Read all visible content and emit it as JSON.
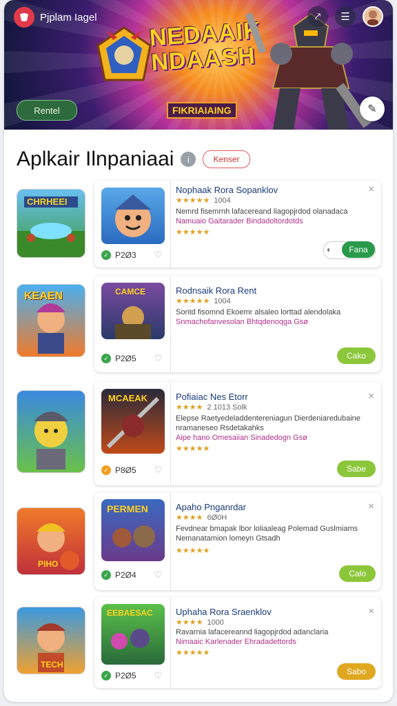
{
  "app": {
    "brand": "Pjplam Iagel"
  },
  "hero": {
    "title": "NEDAAIK NDAASH",
    "subtitle": "FIKRIAIAING",
    "button": "Rentel"
  },
  "section": {
    "title": "Aplkair Ilnpaniaai",
    "filter_button": "Kenser"
  },
  "rows": [
    {
      "left_label": "CHRHEEI",
      "card_label": "",
      "title": "Nophaak Rora Sopanklov",
      "stars": "★★★★★",
      "count": "1004",
      "desc": "Nemrd  fisemrnh lafacereand liagopjrdod olanadaca",
      "desc2": "Namuaio Gaitarader Bindadoltordotds",
      "stars2": "★★★★★",
      "price": "P2Ø3",
      "action": "Fana",
      "action_color": "#2a9a4a",
      "toggle": true
    },
    {
      "left_label": "KEAEN",
      "card_label": "CAMCE",
      "title": "Rodnsaik Rora Rent",
      "stars": "★★★★★",
      "count": "1004",
      "desc": "Sontd  fisomnd Ekoemr alsaleo lorttad alendolaka",
      "desc2": "Snmachofanvesolan Bhtqdenoqga Gsø",
      "stars2": "",
      "price": "P2Ø5",
      "action": "Cako",
      "action_color": "#8cc63a",
      "toggle": false
    },
    {
      "left_label": "",
      "card_label": "MCAEAK",
      "title": "Pofiaiac Nes Etorr",
      "stars": "★★★★",
      "count": "2 1013 Solk",
      "desc": "Elepse Raetyedeladdentereniagun Dierdeniaredubaine nramaneseo Rsdetakahks",
      "desc2": "Aipe hano Omesaiian Sinadedogn Gsø",
      "stars2": "★★★★★",
      "price": "P8Ø5",
      "action": "Sabe",
      "action_color": "#8cc63a",
      "toggle": false
    },
    {
      "left_label": "PIHO",
      "card_label": "PERMEN",
      "title": "Apaho Pnganrdar",
      "stars": "★★★★",
      "count": "6Ø0H",
      "desc": "Fevdnear bmapak lbor loliaaleag Polemad Guslmiams Nemanatamion lomeyn Gtsadh",
      "desc2": "",
      "stars2": "★★★★★",
      "price": "P2Ø4",
      "action": "Calo",
      "action_color": "#8cc63a",
      "toggle": false
    },
    {
      "left_label": "TECH",
      "card_label": "EEBAESAC",
      "title": "Uphaha Rora Sraenklov",
      "stars": "★★★★",
      "count": "1000",
      "desc": "Ravarnia lafacereannd liagopjrdod adanclaria",
      "desc2": "Nimaaic Karlenader Ehradadettords",
      "stars2": "★★★★★",
      "price": "P2Ø5",
      "action": "Sabo",
      "action_color": "#e0a820",
      "toggle": false
    }
  ]
}
